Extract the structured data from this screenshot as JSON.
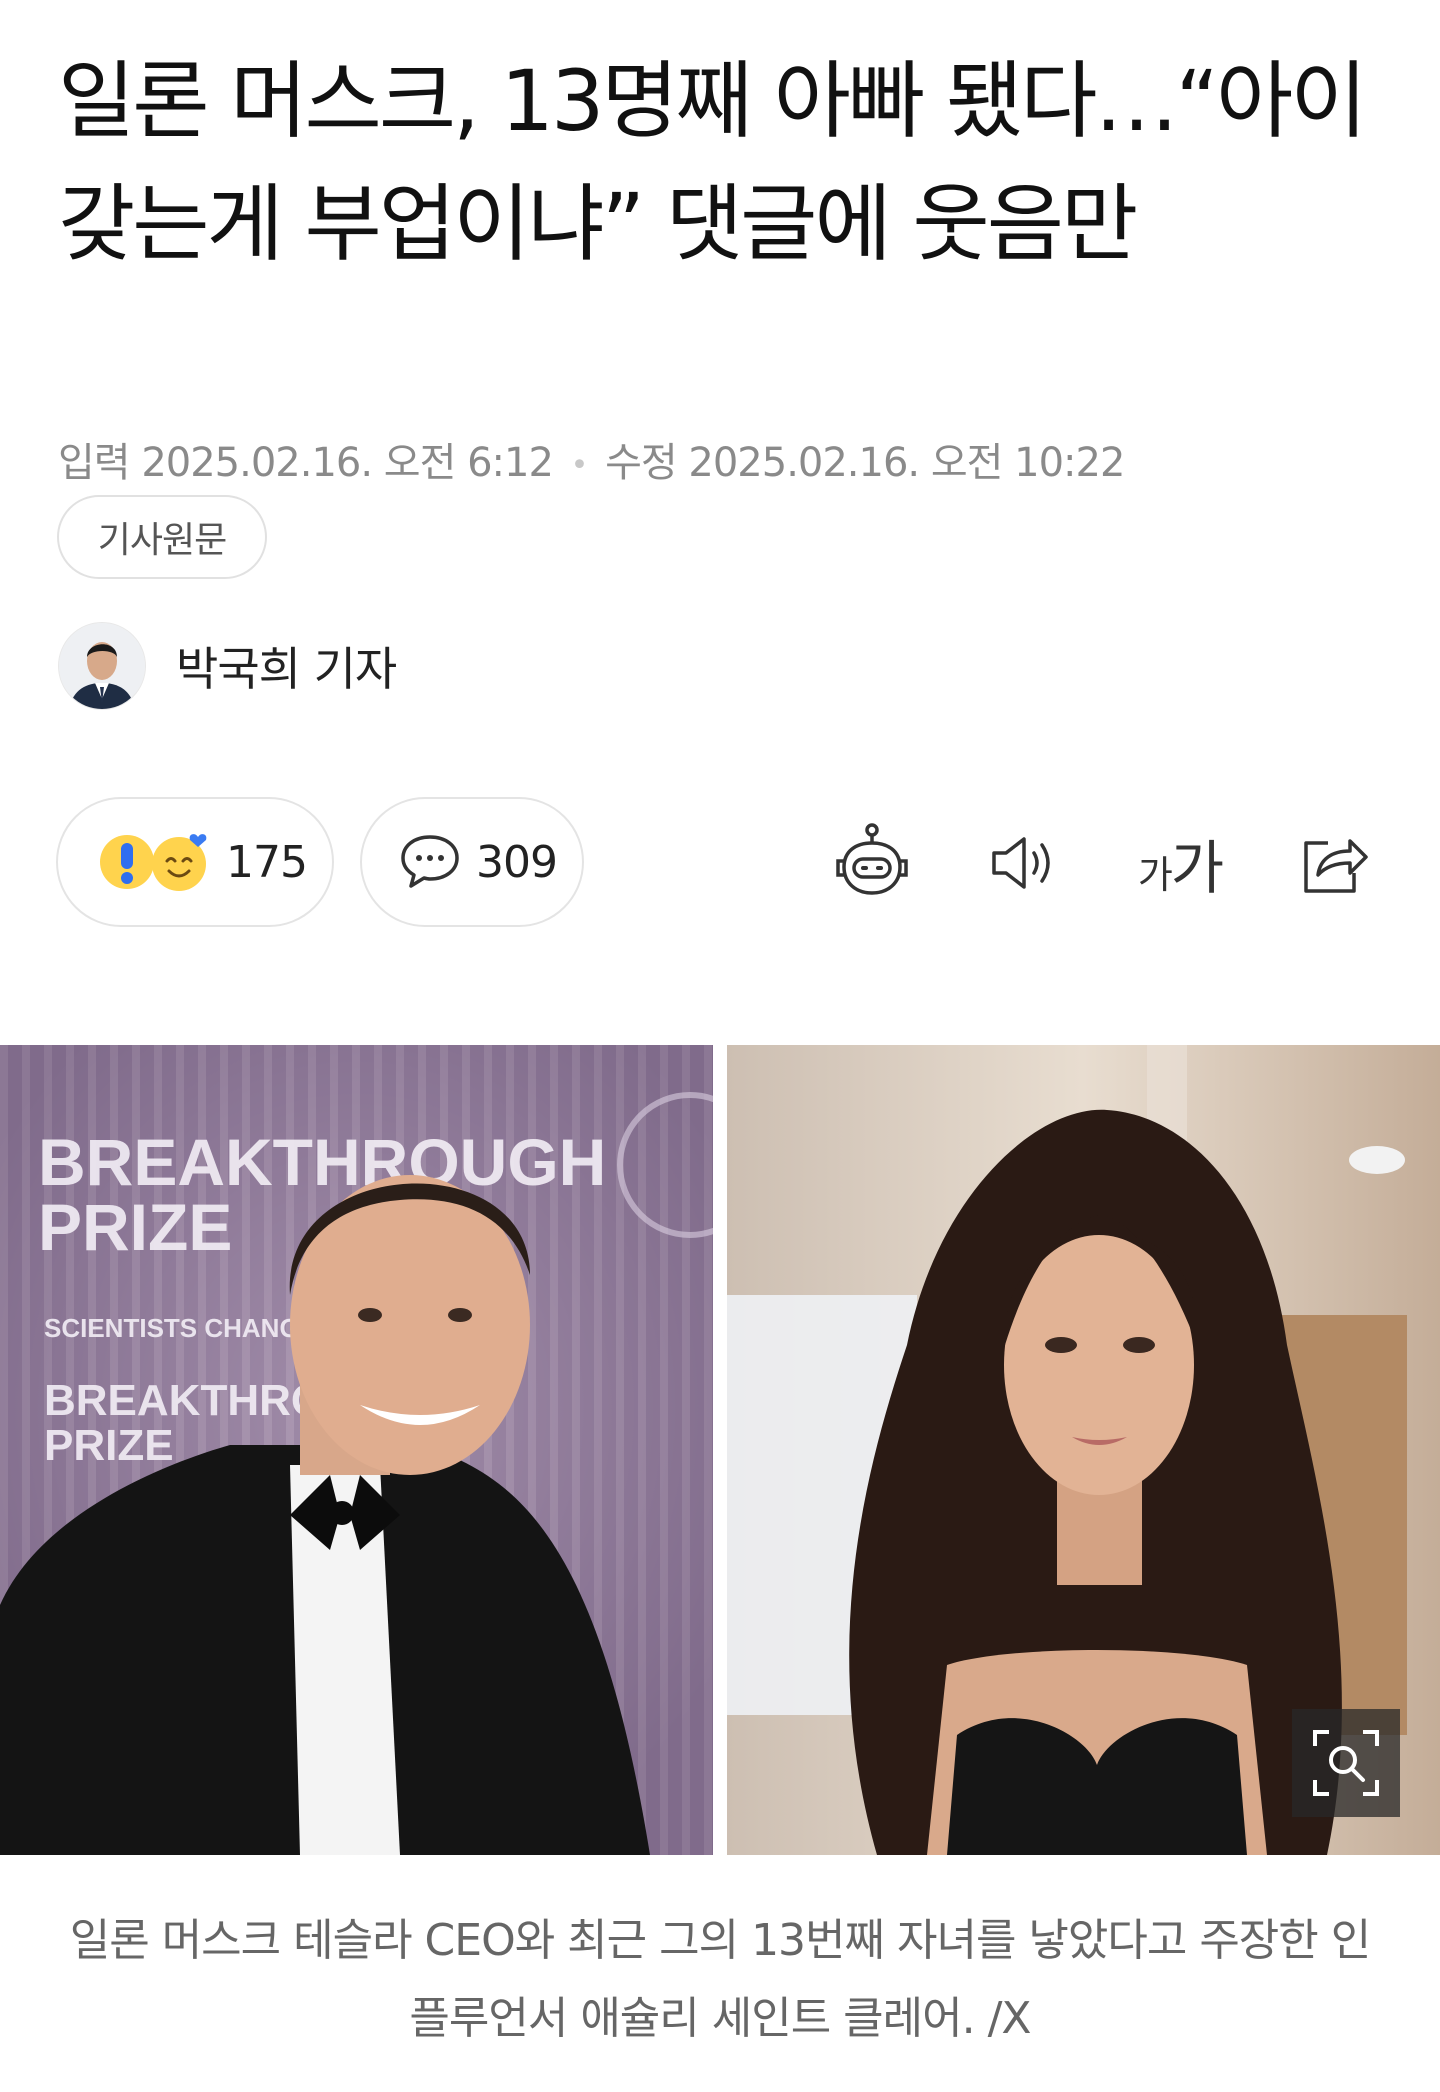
{
  "article": {
    "title": "일론 머스크, 13명째 아빠 됐다…“아이 갖는게 부업이냐” 댓글에 웃음만",
    "published_label": "입력",
    "published": "2025.02.16. 오전 6:12",
    "modified_label": "수정",
    "modified": "2025.02.16. 오전 10:22",
    "original_button": "기사원문"
  },
  "reporter": {
    "name": "박국희 기자"
  },
  "reactions": {
    "count": "175",
    "icons": [
      "exclamation-emoji-icon",
      "heart-smile-emoji-icon"
    ]
  },
  "comments": {
    "count": "309"
  },
  "toolbar": {
    "font_small": "가",
    "font_big": "가"
  },
  "photo": {
    "left_backdrop": [
      "BREAKTHROUGH",
      "PRIZE",
      "SCIENTISTS CHANGING THE WORLD",
      "BREAKTHROUGH",
      "PRIZE"
    ],
    "caption": "일론 머스크 테슬라 CEO와 최근 그의 13번째 자녀를 낳았다고 주장한 인플루언서 애슐리 세인트 클레어. /X"
  },
  "colors": {
    "accent": "#03c75a",
    "text": "#111111",
    "muted": "#8a8a8a",
    "backdrop": "#8d7a98"
  }
}
